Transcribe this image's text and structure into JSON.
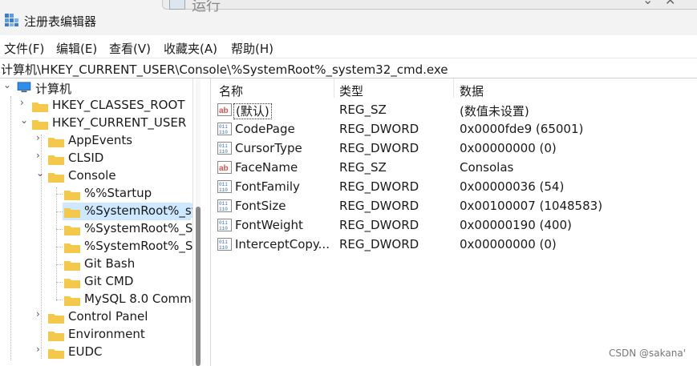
{
  "window": {
    "title": "注册表编辑器",
    "background_window_title": "运行"
  },
  "menu": [
    "文件(F)",
    "编辑(E)",
    "查看(V)",
    "收藏夹(A)",
    "帮助(H)"
  ],
  "address": "计算机\\HKEY_CURRENT_USER\\Console\\%SystemRoot%_system32_cmd.exe",
  "tree": {
    "root": "计算机",
    "nodes": [
      {
        "label": "HKEY_CLASSES_ROOT",
        "expanded": false
      },
      {
        "label": "HKEY_CURRENT_USER",
        "expanded": true
      },
      {
        "label": "AppEvents",
        "expanded": false
      },
      {
        "label": "CLSID",
        "expanded": false
      },
      {
        "label": "Console",
        "expanded": true
      },
      {
        "label": "%%Startup"
      },
      {
        "label": "%SystemRoot%_sy",
        "selected": true
      },
      {
        "label": "%SystemRoot%_S"
      },
      {
        "label": "%SystemRoot%_S"
      },
      {
        "label": "Git Bash"
      },
      {
        "label": "Git CMD"
      },
      {
        "label": "MySQL 8.0 Comma"
      },
      {
        "label": "Control Panel",
        "expanded": false
      },
      {
        "label": "Environment",
        "expanded": false
      },
      {
        "label": "EUDC",
        "expanded": false
      }
    ]
  },
  "columns": [
    "名称",
    "类型",
    "数据"
  ],
  "values": [
    {
      "name": "(默认)",
      "type": "REG_SZ",
      "data": "(数值未设置)",
      "icon": "string-value-icon"
    },
    {
      "name": "CodePage",
      "type": "REG_DWORD",
      "data": "0x0000fde9 (65001)",
      "icon": "binary-value-icon"
    },
    {
      "name": "CursorType",
      "type": "REG_DWORD",
      "data": "0x00000000 (0)",
      "icon": "binary-value-icon"
    },
    {
      "name": "FaceName",
      "type": "REG_SZ",
      "data": "Consolas",
      "icon": "string-value-icon"
    },
    {
      "name": "FontFamily",
      "type": "REG_DWORD",
      "data": "0x00000036 (54)",
      "icon": "binary-value-icon"
    },
    {
      "name": "FontSize",
      "type": "REG_DWORD",
      "data": "0x00100007 (1048583)",
      "icon": "binary-value-icon"
    },
    {
      "name": "FontWeight",
      "type": "REG_DWORD",
      "data": "0x00000190 (400)",
      "icon": "binary-value-icon"
    },
    {
      "name": "InterceptCopy...",
      "type": "REG_DWORD",
      "data": "0x00000000 (0)",
      "icon": "binary-value-icon"
    }
  ],
  "watermark": "CSDN @sakana'",
  "colors": {
    "selection": "#cde8ff",
    "folder": "#f4c84a",
    "string_icon": "#d9534f",
    "binary_icon": "#3c6db4"
  }
}
